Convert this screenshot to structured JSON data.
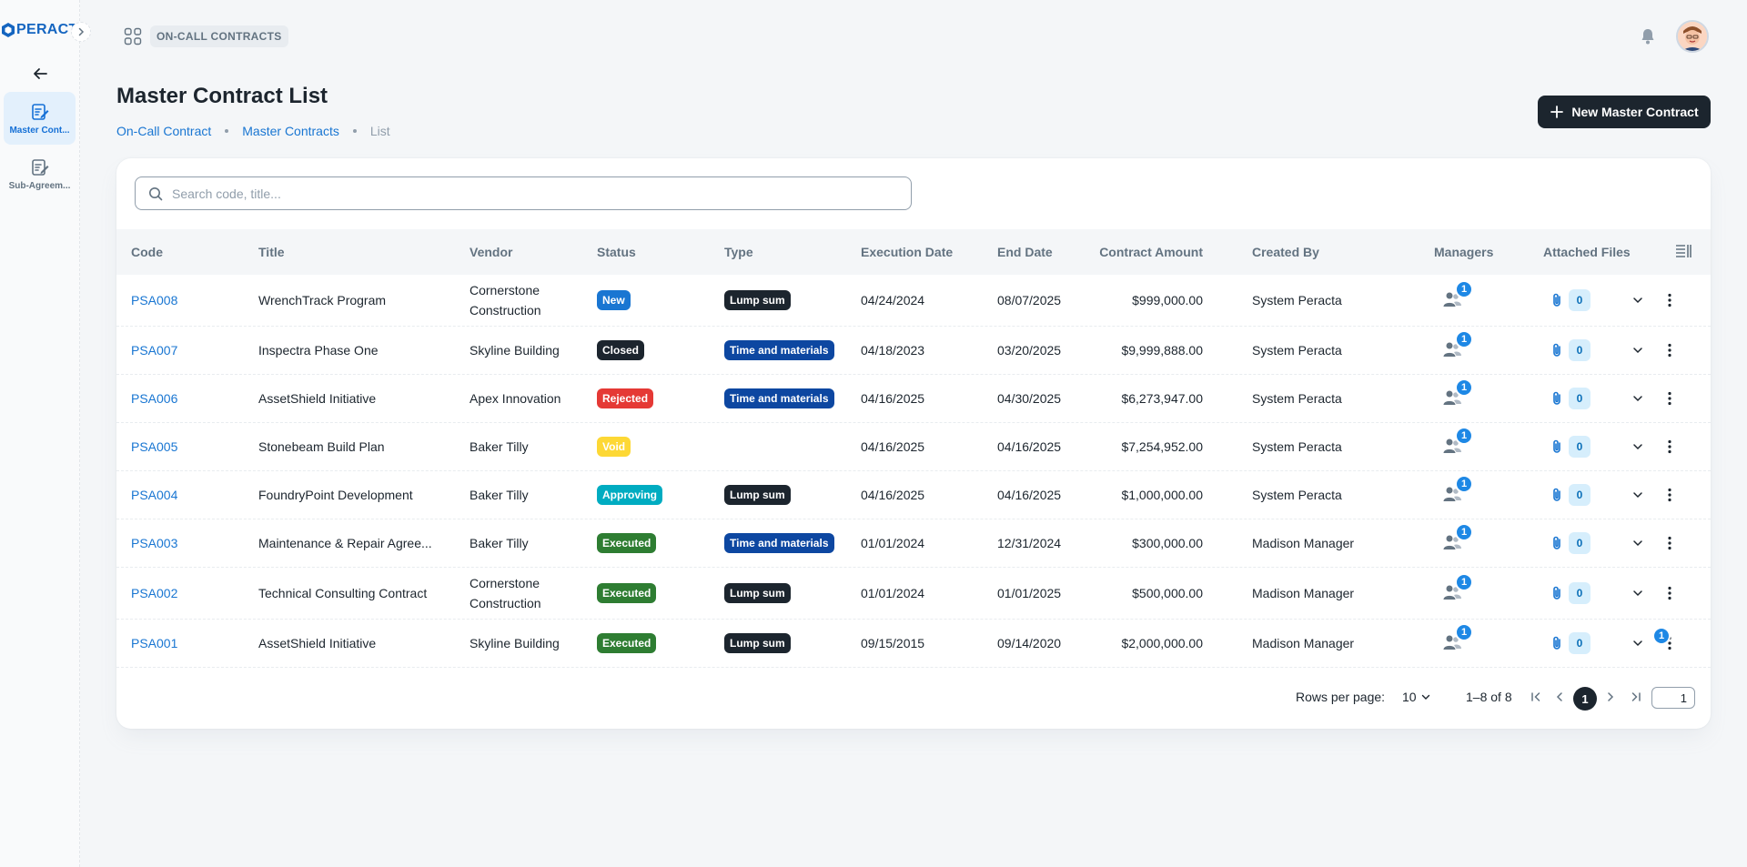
{
  "sidebar": {
    "logo_text": "PERACT",
    "items": [
      {
        "label": "Master Cont...",
        "icon": "contract-edit-icon",
        "active": true
      },
      {
        "label": "Sub-Agreem...",
        "icon": "sub-agreement-icon",
        "active": false
      }
    ]
  },
  "header": {
    "module": "ON-CALL CONTRACTS"
  },
  "page": {
    "title": "Master Contract List",
    "breadcrumb": [
      "On-Call Contract",
      "Master Contracts",
      "List"
    ],
    "new_button": "New Master Contract"
  },
  "search": {
    "placeholder": "Search code, title..."
  },
  "table": {
    "headers": {
      "code": "Code",
      "title": "Title",
      "vendor": "Vendor",
      "status": "Status",
      "type": "Type",
      "execution_date": "Execution Date",
      "end_date": "End Date",
      "amount": "Contract Amount",
      "created_by": "Created By",
      "managers": "Managers",
      "files": "Attached Files"
    },
    "rows": [
      {
        "code": "PSA008",
        "title": "WrenchTrack Program",
        "vendor": "Cornerstone Construction",
        "status": "New",
        "type": "Lump sum",
        "execution_date": "04/24/2024",
        "end_date": "08/07/2025",
        "amount": "$999,000.00",
        "created_by": "System Peracta",
        "managers": "1",
        "files": "0"
      },
      {
        "code": "PSA007",
        "title": "Inspectra Phase One",
        "vendor": "Skyline Building",
        "status": "Closed",
        "type": "Time and materials",
        "execution_date": "04/18/2023",
        "end_date": "03/20/2025",
        "amount": "$9,999,888.00",
        "created_by": "System Peracta",
        "managers": "1",
        "files": "0"
      },
      {
        "code": "PSA006",
        "title": "AssetShield Initiative",
        "vendor": "Apex Innovation",
        "status": "Rejected",
        "type": "Time and materials",
        "execution_date": "04/16/2025",
        "end_date": "04/30/2025",
        "amount": "$6,273,947.00",
        "created_by": "System Peracta",
        "managers": "1",
        "files": "0"
      },
      {
        "code": "PSA005",
        "title": "Stonebeam Build Plan",
        "vendor": "Baker Tilly",
        "status": "Void",
        "type": "",
        "execution_date": "04/16/2025",
        "end_date": "04/16/2025",
        "amount": "$7,254,952.00",
        "created_by": "System Peracta",
        "managers": "1",
        "files": "0"
      },
      {
        "code": "PSA004",
        "title": "FoundryPoint Development",
        "vendor": "Baker Tilly",
        "status": "Approving",
        "type": "Lump sum",
        "execution_date": "04/16/2025",
        "end_date": "04/16/2025",
        "amount": "$1,000,000.00",
        "created_by": "System Peracta",
        "managers": "1",
        "files": "0"
      },
      {
        "code": "PSA003",
        "title": "Maintenance & Repair Agree...",
        "vendor": "Baker Tilly",
        "status": "Executed",
        "type": "Time and materials",
        "execution_date": "01/01/2024",
        "end_date": "12/31/2024",
        "amount": "$300,000.00",
        "created_by": "Madison Manager",
        "managers": "1",
        "files": "0"
      },
      {
        "code": "PSA002",
        "title": "Technical Consulting Contract",
        "vendor": "Cornerstone Construction",
        "status": "Executed",
        "type": "Lump sum",
        "execution_date": "01/01/2024",
        "end_date": "01/01/2025",
        "amount": "$500,000.00",
        "created_by": "Madison Manager",
        "managers": "1",
        "files": "0"
      },
      {
        "code": "PSA001",
        "title": "AssetShield Initiative",
        "vendor": "Skyline Building",
        "status": "Executed",
        "type": "Lump sum",
        "execution_date": "09/15/2015",
        "end_date": "09/14/2020",
        "amount": "$2,000,000.00",
        "created_by": "Madison Manager",
        "managers": "1",
        "files": "0"
      }
    ],
    "expand_badge": "1"
  },
  "status_colors": {
    "New": "#1976d2",
    "Closed": "#1c252e",
    "Rejected": "#e53935",
    "Void": "#fdd835",
    "Approving": "#00acc1",
    "Executed": "#2e7d32"
  },
  "type_colors": {
    "Lump sum": "#1c252e",
    "Time and materials": "#0d47a1"
  },
  "pagination": {
    "rows_label": "Rows per page:",
    "rows_value": "10",
    "range": "1–8 of 8",
    "current_page": "1",
    "page_input": "1"
  }
}
